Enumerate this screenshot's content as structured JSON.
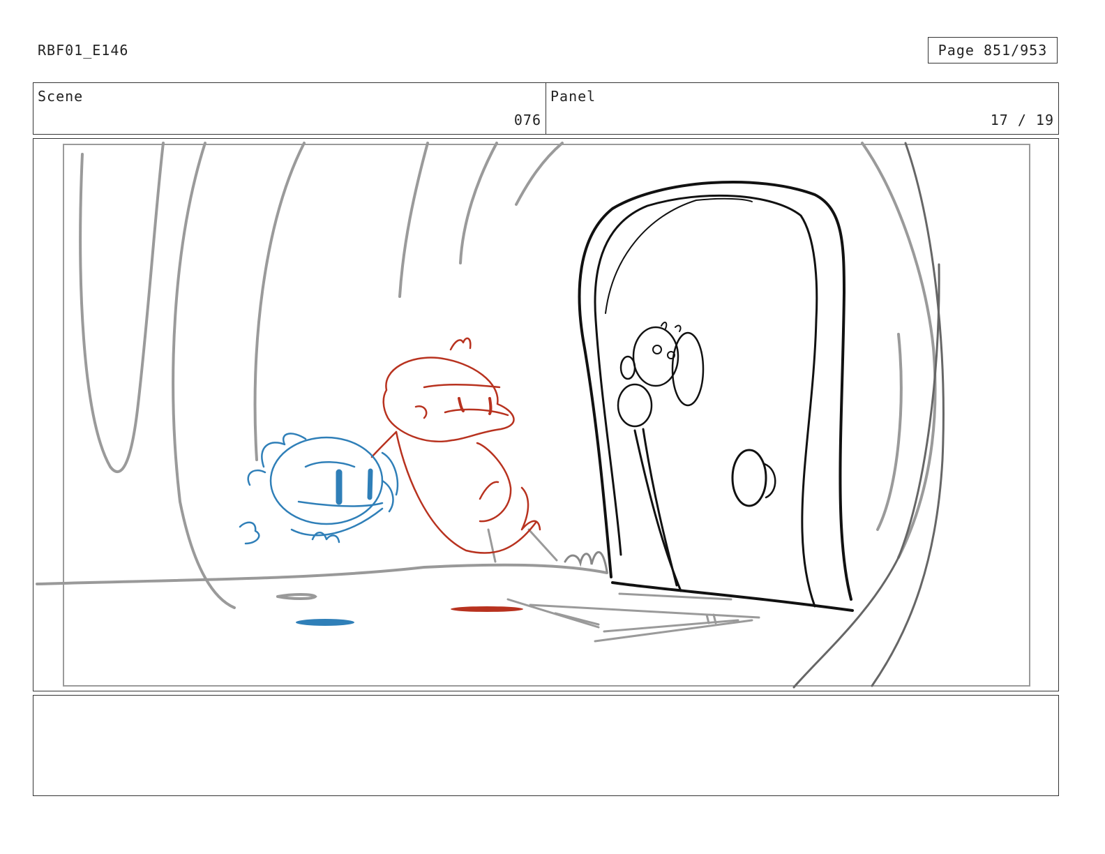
{
  "document": {
    "id": "RBF01_E146",
    "page_label": "Page 851/953"
  },
  "header": {
    "scene_label": "Scene",
    "scene_value": "076",
    "panel_label": "Panel",
    "panel_value": "17 / 19"
  },
  "colors": {
    "sketch_gray": "#9a9a9a",
    "ink_black": "#111111",
    "character_blue": "#2f7fb8",
    "character_red": "#b8321f"
  },
  "notes": {
    "text": ""
  }
}
